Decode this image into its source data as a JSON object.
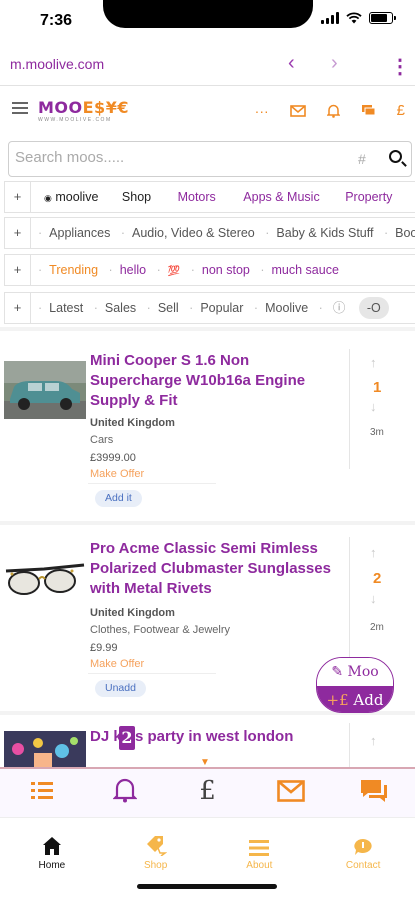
{
  "status": {
    "time": "7:36"
  },
  "browser": {
    "url": "m.moolive.com",
    "back_icon": "chevron-left-icon",
    "forward_icon": "chevron-right-icon",
    "menu_icon": "kebab-icon"
  },
  "header": {
    "logo_main_a": "MOO",
    "logo_main_b": "E$¥€",
    "logo_tag": "WWW.MOOLIVE.COM",
    "icons": [
      "more-icon",
      "mail-icon",
      "bell-icon",
      "chat-icon",
      "pound-icon"
    ],
    "more_text": "···",
    "pound_text": "£"
  },
  "search": {
    "placeholder": "Search moos.....",
    "hash": "#"
  },
  "rows": {
    "r1": [
      "moolive",
      "Shop",
      "Motors",
      "Apps & Music",
      "Property"
    ],
    "r2": [
      "Appliances",
      "Audio, Video & Stereo",
      "Baby & Kids Stuff",
      "Books, Comics &"
    ],
    "r3": [
      "Trending",
      "hello",
      "💯",
      "non stop",
      "much sauce"
    ],
    "r4": [
      "Latest",
      "Sales",
      "Sell",
      "Popular",
      "Moolive",
      "ⓘ",
      "-O"
    ]
  },
  "listings": [
    {
      "title": "Mini Cooper S 1.6 Non Supercharge W10b16a Engine Supply & Fit",
      "location": "United Kingdom",
      "category": "Cars",
      "price": "£3999.00",
      "offer": "Make Offer",
      "button": "Add it",
      "score": "1",
      "age": "3m"
    },
    {
      "title": "Pro Acme Classic Semi Rimless Polarized Clubmaster Sunglasses with Metal Rivets",
      "location": "United Kingdom",
      "category": "Clothes, Footwear & Jewelry",
      "price": "£9.99",
      "offer": "Make Offer",
      "button": "Unadd",
      "score": "2",
      "age": "2m"
    },
    {
      "title": "DJ    kids party in west london"
    }
  ],
  "fab": {
    "moo": "✎ Moo",
    "add_sign": "+£",
    "add": " Add"
  },
  "toolbar": {
    "badge": "2",
    "pound": "£"
  },
  "tabs": [
    {
      "label": "Home",
      "icon": "home-icon"
    },
    {
      "label": "Shop",
      "icon": "shop-tag-icon"
    },
    {
      "label": "About",
      "icon": "menu-icon"
    },
    {
      "label": "Contact",
      "icon": "chat-bubble-icon"
    }
  ],
  "colors": {
    "purple": "#8e2a9e",
    "orange": "#f08a24"
  }
}
